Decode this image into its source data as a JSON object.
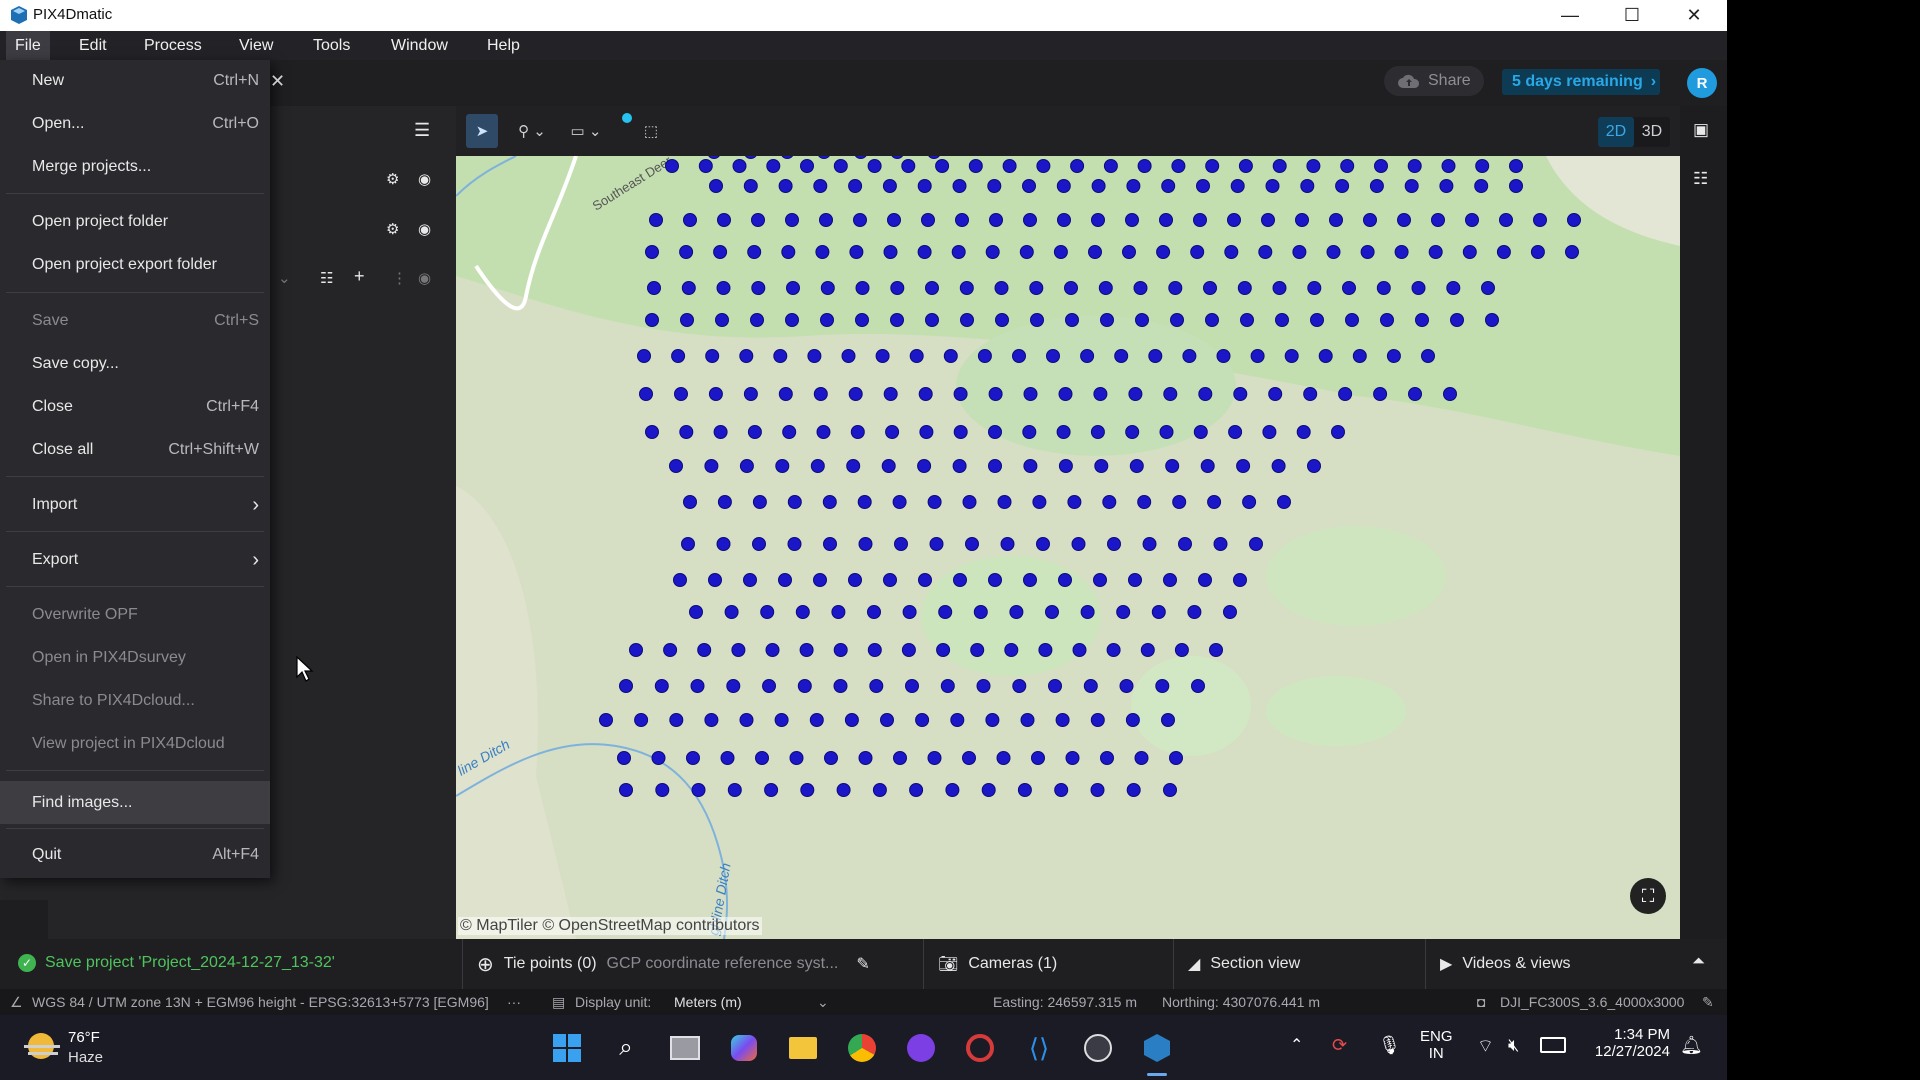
{
  "window": {
    "title": "PIX4Dmatic",
    "controls": [
      "—",
      "☐",
      "✕"
    ]
  },
  "menubar": {
    "items": [
      "File",
      "Edit",
      "Process",
      "View",
      "Tools",
      "Window",
      "Help"
    ]
  },
  "file_menu": {
    "items": [
      {
        "label": "New",
        "shortcut": "Ctrl+N",
        "enabled": true
      },
      {
        "label": "Open...",
        "shortcut": "Ctrl+O",
        "enabled": true
      },
      {
        "label": "Merge projects...",
        "shortcut": "",
        "enabled": true
      },
      {
        "label": "Open project folder",
        "shortcut": "",
        "enabled": true
      },
      {
        "label": "Open project export folder",
        "shortcut": "",
        "enabled": true
      },
      {
        "label": "Save",
        "shortcut": "Ctrl+S",
        "enabled": false
      },
      {
        "label": "Save copy...",
        "shortcut": "",
        "enabled": true
      },
      {
        "label": "Close",
        "shortcut": "Ctrl+F4",
        "enabled": true
      },
      {
        "label": "Close all",
        "shortcut": "Ctrl+Shift+W",
        "enabled": true
      },
      {
        "label": "Import",
        "shortcut": "›",
        "enabled": true
      },
      {
        "label": "Export",
        "shortcut": "›",
        "enabled": true
      },
      {
        "label": "Overwrite OPF",
        "shortcut": "",
        "enabled": false
      },
      {
        "label": "Open in PIX4Dsurvey",
        "shortcut": "",
        "enabled": false
      },
      {
        "label": "Share to PIX4Dcloud...",
        "shortcut": "",
        "enabled": false
      },
      {
        "label": "View project in PIX4Dcloud",
        "shortcut": "",
        "enabled": false
      },
      {
        "label": "Find images...",
        "shortcut": "",
        "enabled": true
      },
      {
        "label": "Quit",
        "shortcut": "Alt+F4",
        "enabled": true
      }
    ]
  },
  "top": {
    "share_label": "Share",
    "trial_label": "5 days remaining",
    "avatar_initial": "R"
  },
  "view_toggle": {
    "option_2d": "2D",
    "option_3d": "3D",
    "selected": "2D"
  },
  "map": {
    "attribution": "© MapTiler  © OpenStreetMap contributors",
    "labels": {
      "road": "Southeast Deer",
      "ditch_left": "line Ditch",
      "ditch_bottom": "ghline Ditch"
    },
    "marker_color": "#1b17c8"
  },
  "status": {
    "save_message": "Save project 'Project_2024-12-27_13-32'",
    "tie_points": "Tie points (0)",
    "gcp_crs": "GCP coordinate reference syst...",
    "cameras": "Cameras (1)",
    "section_view": "Section view",
    "videos_views": "Videos & views"
  },
  "coords": {
    "crs": "WGS 84 / UTM zone 13N + EGM96 height - EPSG:32613+5773 [EGM96]",
    "crs_more": "···",
    "display_unit_label": "Display unit:",
    "display_unit_value": "Meters (m)",
    "easting": "Easting: 246597.315 m",
    "northing": "Northing: 4307076.441 m",
    "camera": "DJI_FC300S_3.6_4000x3000"
  },
  "taskbar": {
    "temperature": "76°F",
    "condition": "Haze",
    "lang_top": "ENG",
    "lang_bottom": "IN",
    "time": "1:34 PM",
    "date": "12/27/2024"
  }
}
